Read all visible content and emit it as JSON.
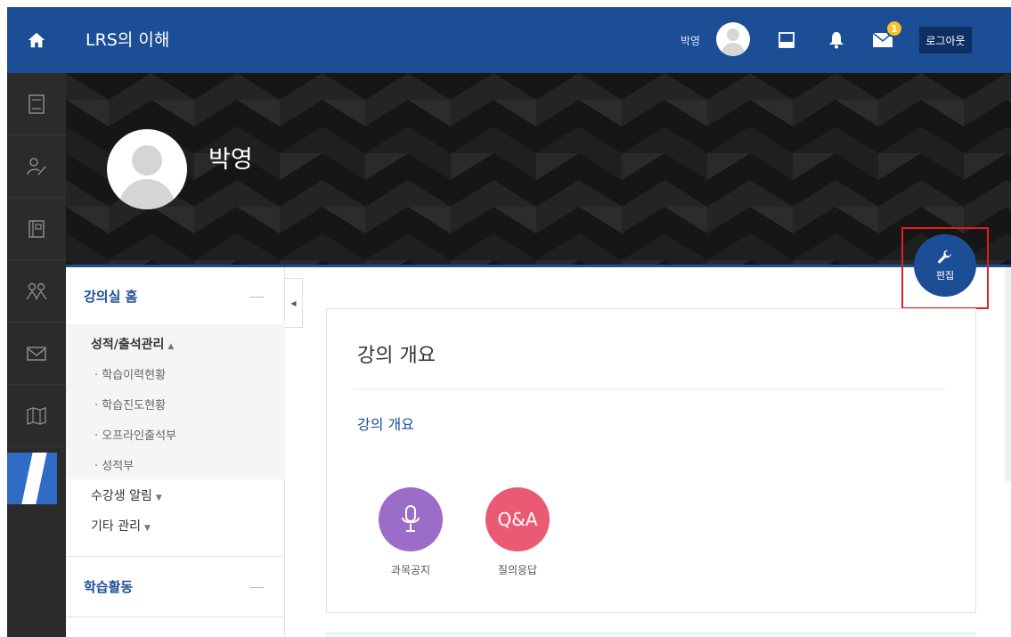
{
  "header": {
    "course_title": "LRS의 이해",
    "user_name": "박영",
    "notification_count": "1",
    "logout_label": "로그아웃"
  },
  "profile": {
    "name": "박영"
  },
  "edit_button": {
    "label": "편집"
  },
  "nav": {
    "section_home": "강의실 홈",
    "grades_group": "성적/출석관리",
    "grades_items": [
      "학습이력현황",
      "학습진도현황",
      "오프라인출석부",
      "성적부"
    ],
    "student_alert": "수강생 알림",
    "other_mgmt": "기타 관리",
    "section_activity": "학습활동"
  },
  "main": {
    "title": "강의 개요",
    "overview_link": "강의 개요",
    "activities": [
      {
        "label": "과목공지",
        "icon": "microphone-icon",
        "color": "#9b6dc8"
      },
      {
        "label": "질의응답",
        "icon": "Q&A",
        "color": "#ea5a73"
      }
    ]
  },
  "colors": {
    "brand": "#1c4e96",
    "highlight": "#e41e1e"
  }
}
